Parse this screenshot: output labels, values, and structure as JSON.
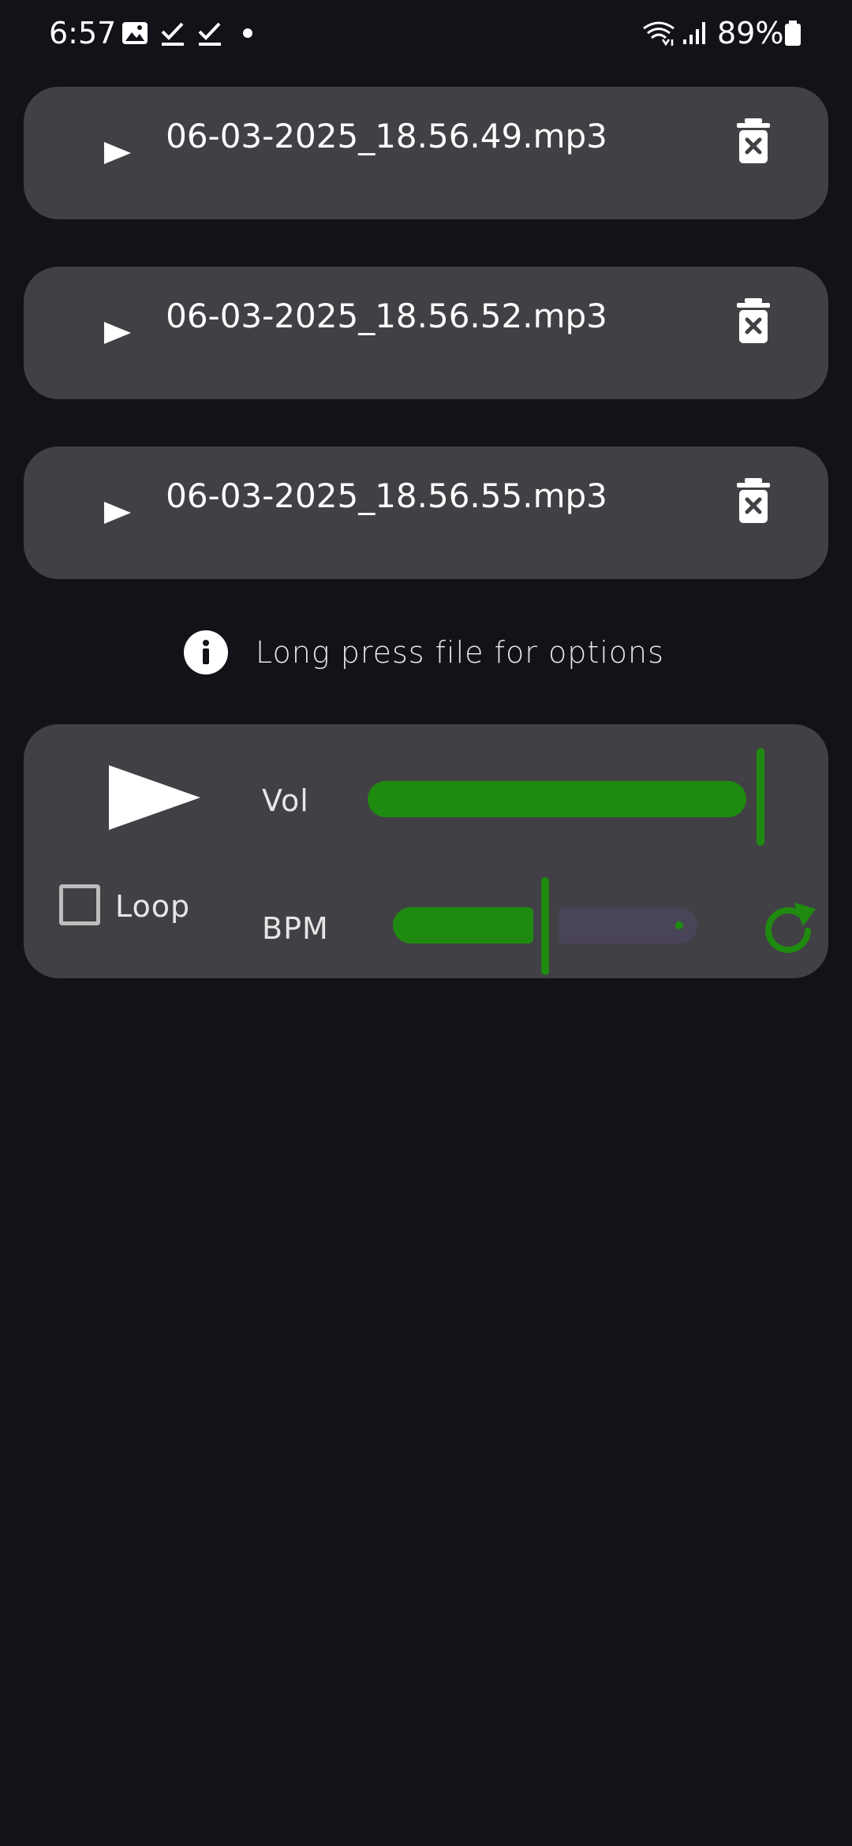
{
  "status_bar": {
    "time": "6:57",
    "battery": "89%",
    "icons": [
      "image-icon",
      "check-icon",
      "check-icon",
      "dot-icon",
      "wifi-icon",
      "signal-icon",
      "battery-icon"
    ]
  },
  "files": [
    {
      "name": "06-03-2025_18.56.49.mp3"
    },
    {
      "name": "06-03-2025_18.56.52.mp3"
    },
    {
      "name": "06-03-2025_18.56.55.mp3"
    }
  ],
  "info": {
    "text": "Long press file for options"
  },
  "player": {
    "vol_label": "Vol",
    "volume_level": 1.0,
    "loop_label": "Loop",
    "loop_checked": false,
    "bpm_label": "BPM",
    "bpm_level": 0.5
  },
  "colors": {
    "background": "#141218",
    "card": "#414045",
    "accent_green": "#1f8a10",
    "inactive_track": "#4a4458"
  }
}
